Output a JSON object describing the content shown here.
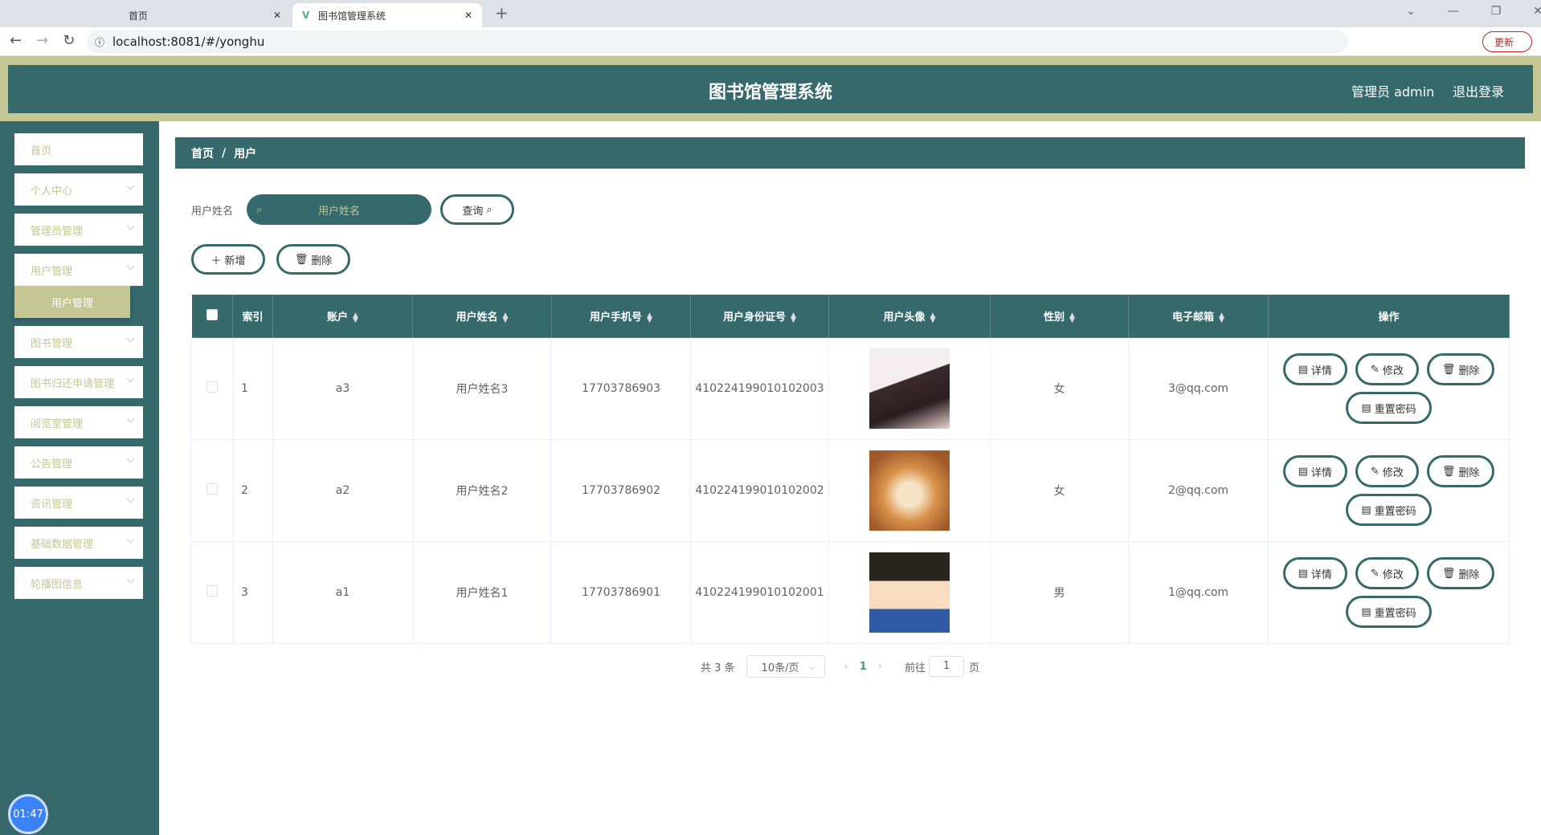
{
  "browser": {
    "tabs": [
      {
        "label": "首页"
      },
      {
        "label": "图书馆管理系统"
      }
    ],
    "url": "localhost:8081/#/yonghu",
    "update_label": "更新"
  },
  "header": {
    "title": "图书馆管理系统",
    "user": "管理员 admin",
    "logout": "退出登录"
  },
  "sidebar": {
    "items": [
      {
        "label": "首页"
      },
      {
        "label": "个人中心"
      },
      {
        "label": "管理员管理"
      },
      {
        "label": "用户管理"
      },
      {
        "label": "图书管理"
      },
      {
        "label": "图书归还申请管理"
      },
      {
        "label": "阅览室管理"
      },
      {
        "label": "公告管理"
      },
      {
        "label": "资讯管理"
      },
      {
        "label": "基础数据管理"
      },
      {
        "label": "轮播图信息"
      }
    ],
    "submenu": "用户管理"
  },
  "breadcrumb": {
    "home": "首页",
    "sep": "/",
    "current": "用户"
  },
  "search": {
    "label": "用户姓名",
    "placeholder": "用户姓名",
    "button": "查询"
  },
  "actions": {
    "add": "新增",
    "delete": "删除"
  },
  "table": {
    "headers": [
      "索引",
      "账户",
      "用户姓名",
      "用户手机号",
      "用户身份证号",
      "用户头像",
      "性别",
      "电子邮箱",
      "操作"
    ],
    "rows": [
      {
        "index": "1",
        "account": "a3",
        "name": "用户姓名3",
        "phone": "17703786903",
        "id": "410224199010102003",
        "gender": "女",
        "email": "3@qq.com",
        "avatar": "girl"
      },
      {
        "index": "2",
        "account": "a2",
        "name": "用户姓名2",
        "phone": "17703786902",
        "id": "410224199010102002",
        "gender": "女",
        "email": "2@qq.com",
        "avatar": "shiba-dog"
      },
      {
        "index": "3",
        "account": "a1",
        "name": "用户姓名1",
        "phone": "17703786901",
        "id": "410224199010102001",
        "gender": "男",
        "email": "1@qq.com",
        "avatar": "cartoon-boy"
      }
    ],
    "row_actions": {
      "detail": "详情",
      "edit": "修改",
      "delete": "删除",
      "reset": "重置密码"
    }
  },
  "pagination": {
    "total": "共 3 条",
    "page_size": "10条/页",
    "current": "1",
    "goto": "前往",
    "goto_value": "1",
    "page_suffix": "页"
  },
  "timer": "01:47",
  "colors": {
    "primary": "#35696c",
    "accent": "#c4c693"
  }
}
